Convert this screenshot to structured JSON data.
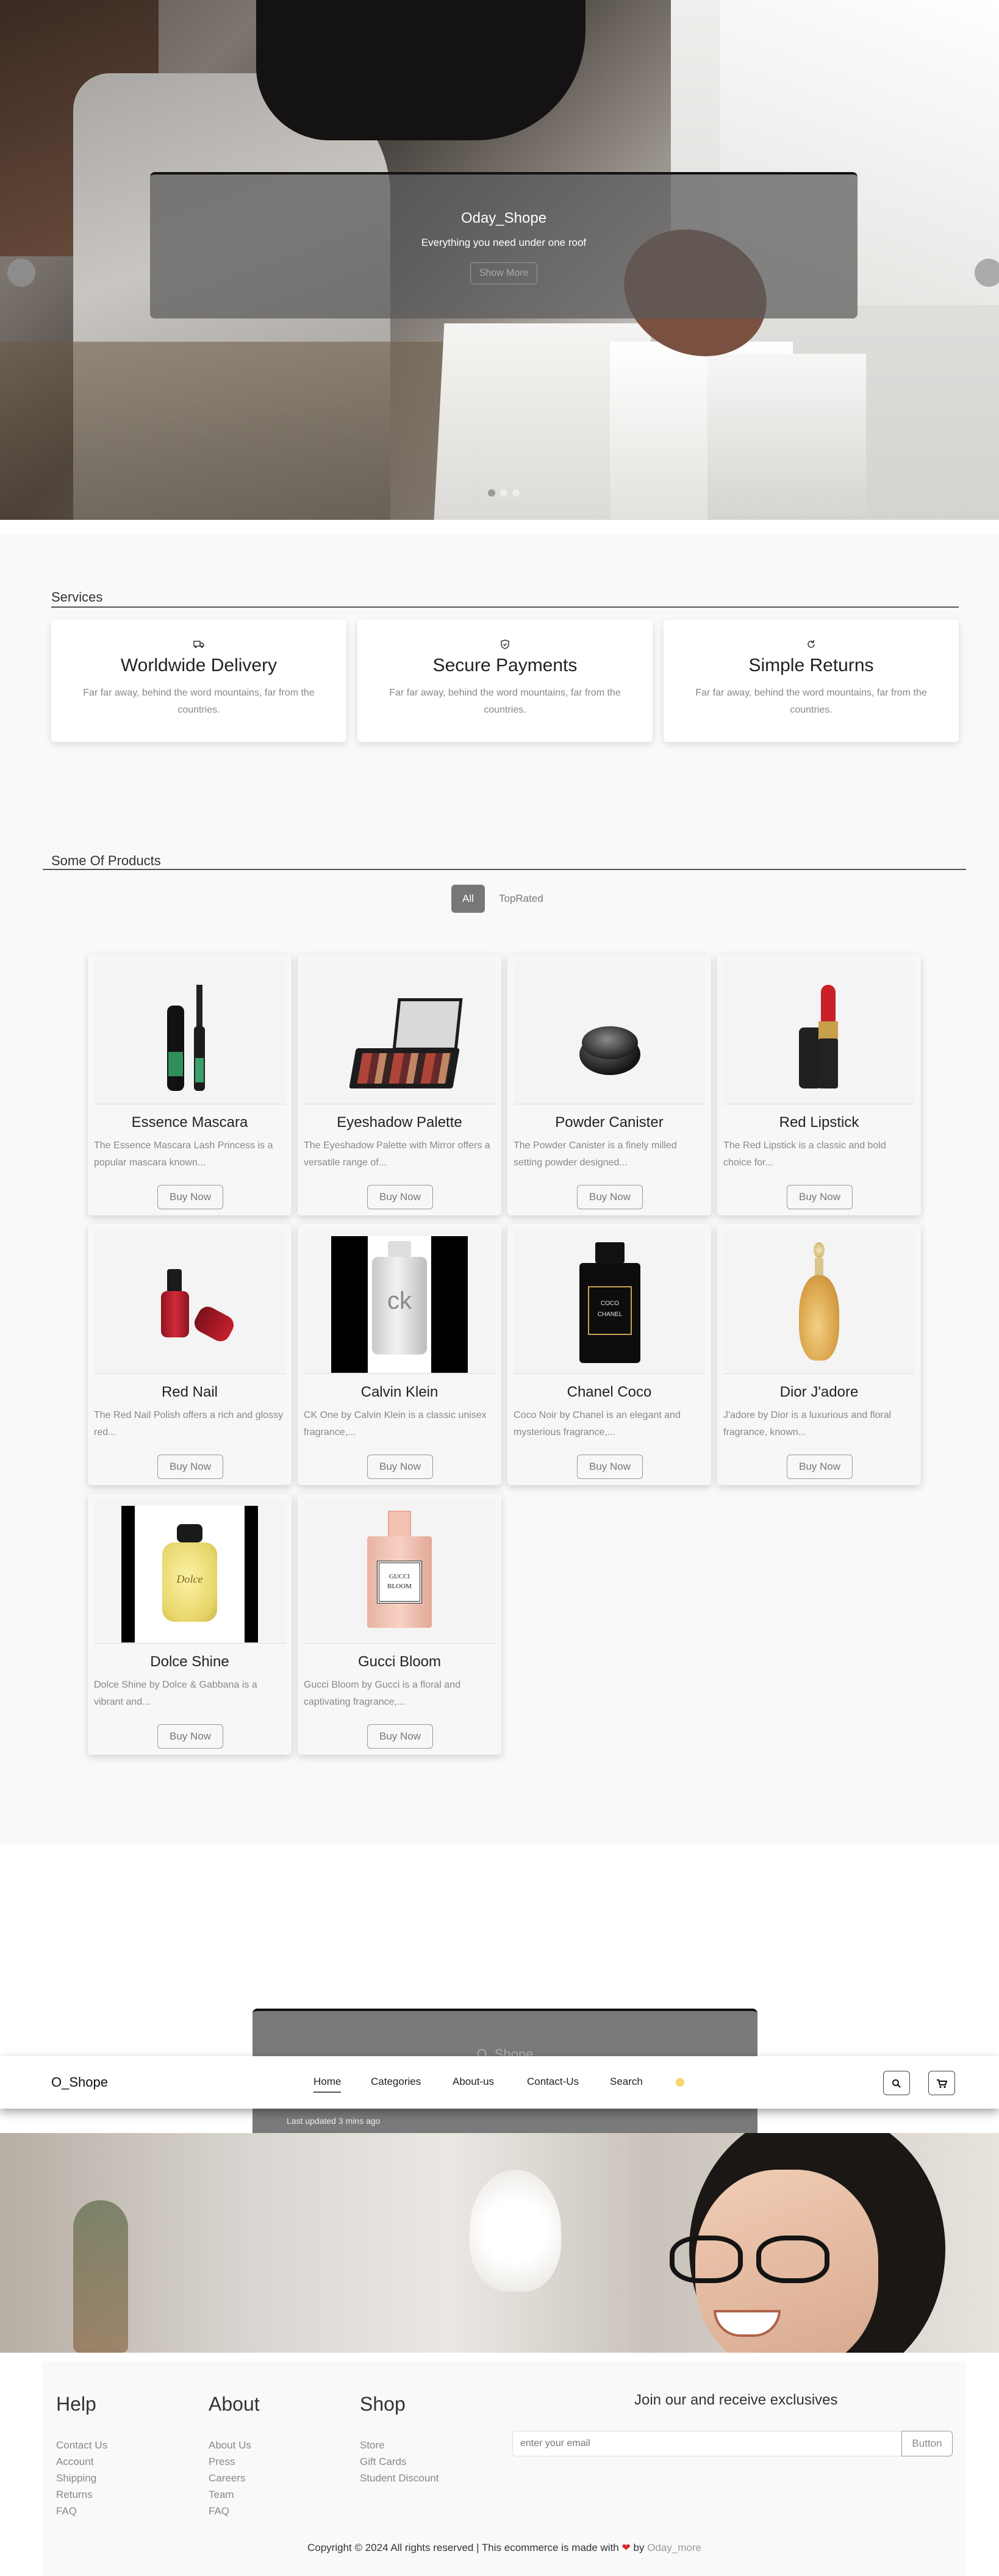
{
  "hero": {
    "title": "Oday_Shope",
    "subtitle": "Everything you need under one roof",
    "button_label": "Show More"
  },
  "services": {
    "heading": "Services",
    "items": [
      {
        "icon": "truck-icon",
        "title": "Worldwide Delivery",
        "description": "Far far away, behind the word mountains, far from the countries."
      },
      {
        "icon": "shield-icon",
        "title": "Secure Payments",
        "description": "Far far away, behind the word mountains, far from the countries."
      },
      {
        "icon": "refresh-icon",
        "title": "Simple Returns",
        "description": "Far far away, behind the word mountains, far from the countries."
      }
    ]
  },
  "products": {
    "heading": "Some Of Products",
    "filters": [
      "All",
      "TopRated"
    ],
    "buy_label": "Buy Now",
    "items": [
      {
        "name": "Essence Mascara",
        "description": "The Essence Mascara Lash Princess is a popular mascara known..."
      },
      {
        "name": "Eyeshadow Palette",
        "description": "The Eyeshadow Palette with Mirror offers a versatile range of..."
      },
      {
        "name": "Powder Canister",
        "description": "The Powder Canister is a finely milled setting powder designed..."
      },
      {
        "name": "Red Lipstick",
        "description": "The Red Lipstick is a classic and bold choice for..."
      },
      {
        "name": "Red Nail",
        "description": "The Red Nail Polish offers a rich and glossy red..."
      },
      {
        "name": "Calvin Klein",
        "description": "CK One by Calvin Klein is a classic unisex fragrance,..."
      },
      {
        "name": "Chanel Coco",
        "description": "Coco Noir by Chanel is an elegant and mysterious fragrance,..."
      },
      {
        "name": "Dior J'adore",
        "description": "J'adore by Dior is a luxurious and floral fragrance, known..."
      },
      {
        "name": "Dolce Shine",
        "description": "Dolce Shine by Dolce & Gabbana is a vibrant and..."
      },
      {
        "name": "Gucci Bloom",
        "description": "Gucci Bloom by Gucci is a floral and captivating fragrance,..."
      }
    ],
    "image_labels": {
      "ck": "ck",
      "chanel": "COCO CHANEL",
      "gucci": "GUCCI BLOOM",
      "dolce": "Dolce"
    }
  },
  "alert": {
    "title": "O_Shope",
    "updated": "Last updated 3 mins ago"
  },
  "navbar": {
    "brand": "O_Shope",
    "items": [
      "Home",
      "Categories",
      "About-us",
      "Contact-Us",
      "Search"
    ],
    "search_icon": "search-icon",
    "cart_icon": "cart-icon"
  },
  "footer": {
    "help": {
      "title": "Help",
      "links": [
        "Contact Us",
        "Account",
        "Shipping",
        "Returns",
        "FAQ"
      ]
    },
    "about": {
      "title": "About",
      "links": [
        "About Us",
        "Press",
        "Careers",
        "Team",
        "FAQ"
      ]
    },
    "shop": {
      "title": "Shop",
      "links": [
        "Store",
        "Gift Cards",
        "Student Discount"
      ]
    },
    "join_title": "Join our and receive exclusives",
    "email_placeholder": "enter your email",
    "button_label": "Button",
    "copyright": "Copyright © 2024 All rights reserved | This ecommerce is made with",
    "by": "by",
    "author": "Oday_more"
  }
}
